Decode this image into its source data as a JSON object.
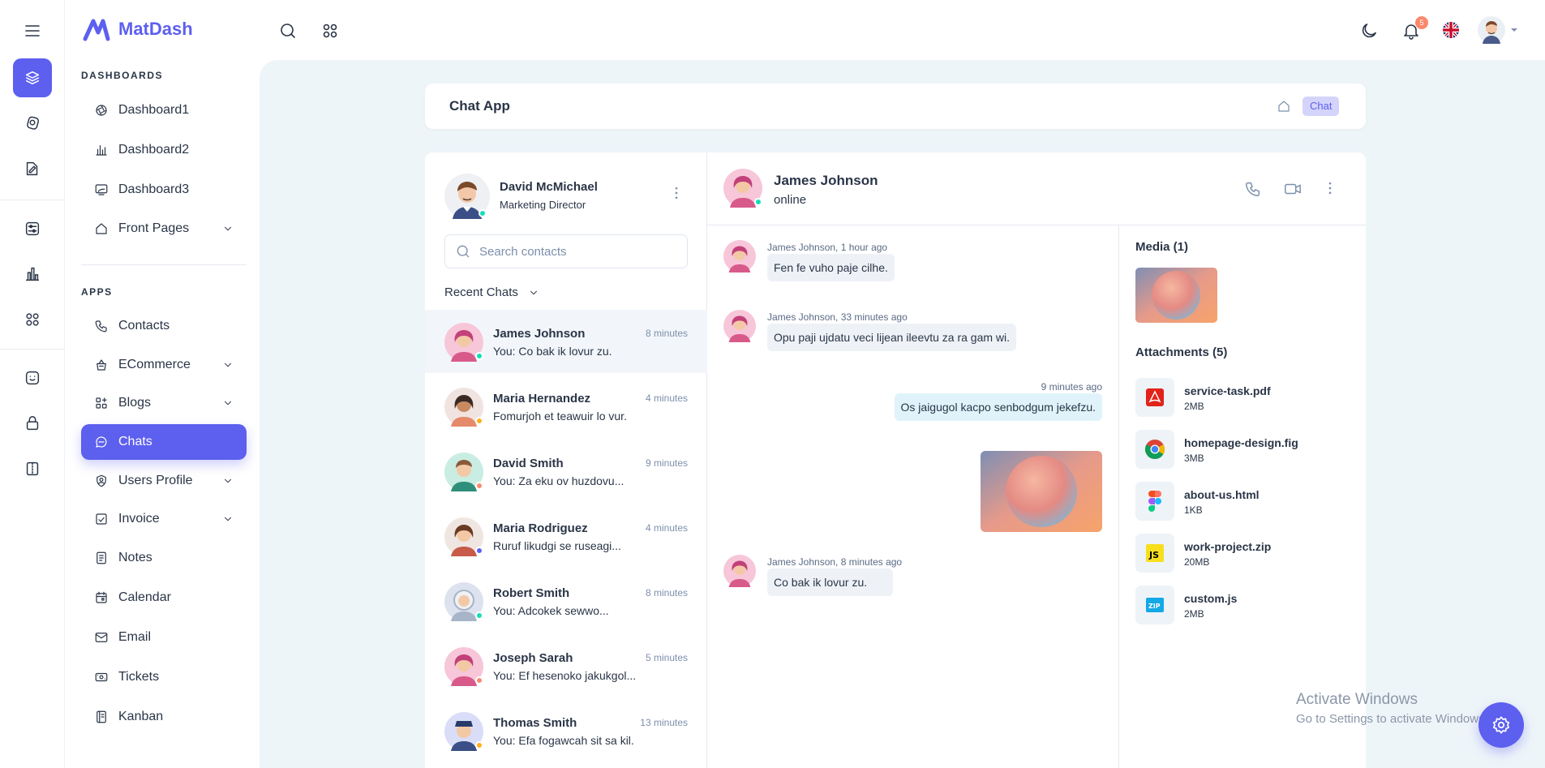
{
  "brand": {
    "name": "MatDash",
    "color": "#5D5FEF"
  },
  "sidebar": {
    "sections": [
      {
        "title": "DASHBOARDS"
      },
      {
        "title": "APPS"
      }
    ],
    "items": [
      {
        "label": "Dashboard1",
        "icon": "aperture-icon"
      },
      {
        "label": "Dashboard2",
        "icon": "chart-bars-icon"
      },
      {
        "label": "Dashboard3",
        "icon": "screen-share-icon"
      },
      {
        "label": "Front Pages",
        "icon": "home-icon",
        "expandable": true
      },
      {
        "label": "Contacts",
        "icon": "phone-icon"
      },
      {
        "label": "ECommerce",
        "icon": "basket-icon",
        "expandable": true
      },
      {
        "label": "Blogs",
        "icon": "chart-donut-icon",
        "expandable": true
      },
      {
        "label": "Chats",
        "icon": "message-icon",
        "active": true
      },
      {
        "label": "Users Profile",
        "icon": "user-circle-icon",
        "expandable": true
      },
      {
        "label": "Invoice",
        "icon": "file-check-icon",
        "expandable": true
      },
      {
        "label": "Notes",
        "icon": "notes-icon"
      },
      {
        "label": "Calendar",
        "icon": "calendar-icon"
      },
      {
        "label": "Email",
        "icon": "mail-icon"
      },
      {
        "label": "Tickets",
        "icon": "ticket-icon"
      },
      {
        "label": "Kanban",
        "icon": "notebook-icon"
      }
    ]
  },
  "header": {
    "notification_count": "5"
  },
  "breadcrumb": {
    "title": "Chat App",
    "badge": "Chat"
  },
  "me": {
    "name": "David McMichael",
    "role": "Marketing Director"
  },
  "search": {
    "placeholder": "Search contacts"
  },
  "recent_label": "Recent Chats",
  "contacts": [
    {
      "name": "James Johnson",
      "time": "8 minutes",
      "message": "You: Co bak ik lovur zu.",
      "status": "#13DEB9",
      "active": true
    },
    {
      "name": "Maria Hernandez",
      "time": "4 minutes",
      "message": "Fomurjoh et teawuir lo vur.",
      "status": "#FFAE1F"
    },
    {
      "name": "David Smith",
      "time": "9 minutes",
      "message": "You: Za eku ov huzdovu...",
      "status": "#FA896B"
    },
    {
      "name": "Maria Rodriguez",
      "time": "4 minutes",
      "message": "Ruruf likudgi se ruseagi...",
      "status": "#5D5FEF"
    },
    {
      "name": "Robert Smith",
      "time": "8 minutes",
      "message": "You: Adcokek sewwo...",
      "status": "#13DEB9"
    },
    {
      "name": "Joseph Sarah",
      "time": "5 minutes",
      "message": "You: Ef hesenoko jakukgol...",
      "status": "#FA896B"
    },
    {
      "name": "Thomas Smith",
      "time": "13 minutes",
      "message": "You: Efa fogawcah sit sa kil.",
      "status": "#FFAE1F"
    }
  ],
  "conversation": {
    "name": "James Johnson",
    "status": "online",
    "messages": [
      {
        "meta": "James Johnson, 1 hour ago",
        "text": "Fen fe vuho paje cilhe.",
        "dir": "in"
      },
      {
        "meta": "James Johnson, 33 minutes ago",
        "text": "Opu paji ujdatu veci lijean ileevtu za ra gam wi.",
        "dir": "in"
      },
      {
        "meta": "9 minutes ago",
        "text": "Os jaigugol kacpo senbodgum jekefzu.",
        "dir": "out"
      },
      {
        "meta": "James Johnson, 8 minutes ago",
        "text": "Co bak ik lovur zu.",
        "dir": "in"
      }
    ]
  },
  "media": {
    "title": "Media (1)"
  },
  "attachments": {
    "title": "Attachments (5)",
    "items": [
      {
        "name": "service-task.pdf",
        "size": "2MB",
        "icon": "pdf-icon"
      },
      {
        "name": "homepage-design.fig",
        "size": "3MB",
        "icon": "chrome-icon"
      },
      {
        "name": "about-us.html",
        "size": "1KB",
        "icon": "figma-icon"
      },
      {
        "name": "work-project.zip",
        "size": "20MB",
        "icon": "javascript-icon"
      },
      {
        "name": "custom.js",
        "size": "2MB",
        "icon": "zip-icon"
      }
    ]
  },
  "watermark": {
    "line1": "Activate Windows",
    "line2": "Go to Settings to activate Windows."
  }
}
